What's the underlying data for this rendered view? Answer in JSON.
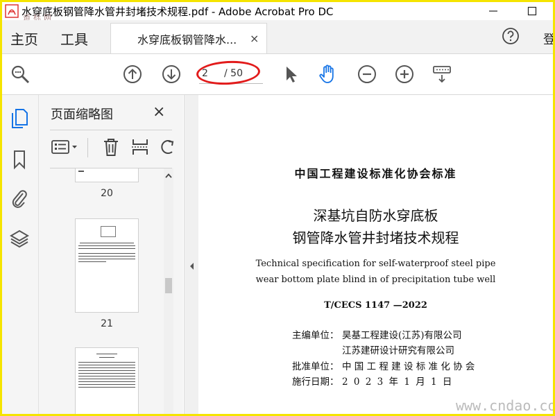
{
  "window": {
    "title": "水穿底板钢管降水管井封堵技术规程.pdf - Adobe Acrobat Pro DC",
    "watermark_top": "道标网"
  },
  "menu": {
    "home": "主页",
    "tools": "工具",
    "tab_label": "水穿底板钢管降水...",
    "tab_close": "×",
    "signin": "登"
  },
  "toolbar": {
    "page_current": "2",
    "page_total": "/ 50"
  },
  "panel": {
    "title": "页面缩略图",
    "close": "×",
    "thumb_labels": [
      "20",
      "21"
    ]
  },
  "document": {
    "org_title": "中国工程建设标准化协会标准",
    "title_line1": "深基坑自防水穿底板",
    "title_line2": "钢管降水管井封堵技术规程",
    "en_line1": "Technical specification for self-waterproof steel pipe",
    "en_line2": "wear bottom plate blind in of precipitation tube well",
    "code": "T/CECS 1147 —2022",
    "editor_label": "主编单位：",
    "editor1": "昊基工程建设(江苏)有限公司",
    "editor2": "江苏建研设计研究有限公司",
    "approver_label": "批准单位：",
    "approver": "中 国 工 程 建 设 标 准 化 协 会",
    "date_label": "施行日期：",
    "date": "2 0 2 3  年   1  月  1  日"
  },
  "watermark_bottom": "www.cndao.com",
  "colors": {
    "frame": "#f5e400",
    "accent": "#1473e6",
    "annotation": "#e21b1b"
  }
}
